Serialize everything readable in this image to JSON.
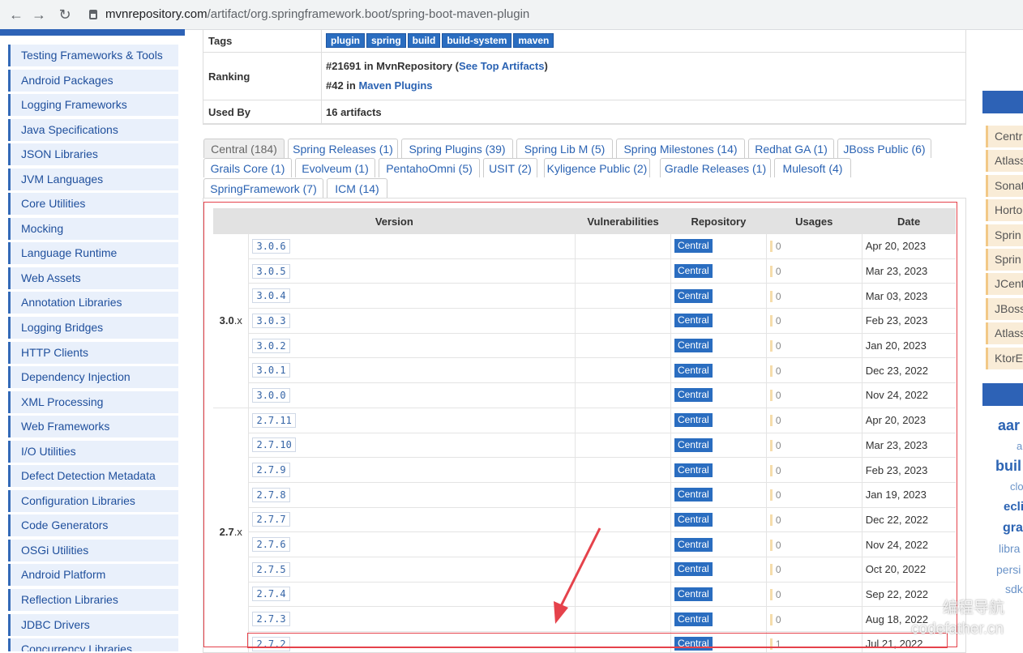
{
  "browser": {
    "url_host": "mvnrepository.com",
    "url_path": "/artifact/org.springframework.boot/spring-boot-maven-plugin"
  },
  "sidebar": {
    "items": [
      "Testing Frameworks & Tools",
      "Android Packages",
      "Logging Frameworks",
      "Java Specifications",
      "JSON Libraries",
      "JVM Languages",
      "Core Utilities",
      "Mocking",
      "Language Runtime",
      "Web Assets",
      "Annotation Libraries",
      "Logging Bridges",
      "HTTP Clients",
      "Dependency Injection",
      "XML Processing",
      "Web Frameworks",
      "I/O Utilities",
      "Defect Detection Metadata",
      "Configuration Libraries",
      "Code Generators",
      "OSGi Utilities",
      "Android Platform",
      "Reflection Libraries",
      "JDBC Drivers",
      "Concurrency Libraries"
    ]
  },
  "info": {
    "tags_label": "Tags",
    "tags": [
      "plugin",
      "spring",
      "build",
      "build-system",
      "maven"
    ],
    "ranking_label": "Ranking",
    "ranking_line1_prefix": "#21691 in MvnRepository (",
    "ranking_line1_link": "See Top Artifacts",
    "ranking_line1_suffix": ")",
    "ranking_line2_prefix": "#42 in ",
    "ranking_line2_link": "Maven Plugins",
    "usedby_label": "Used By",
    "usedby_value": "16 artifacts"
  },
  "tabs": {
    "row1": [
      "Central (184)",
      "Spring Releases (1)",
      "Spring Plugins (39)",
      "Spring Lib M (5)",
      "Spring Milestones (14)",
      "Redhat GA (1)",
      "JBoss Public (6)"
    ],
    "row2": [
      "Grails Core (1)",
      "Evolveum (1)",
      "PentahoOmni (5)",
      "USIT (2)",
      "Kyligence Public (2)",
      "Gradle Releases (1)",
      "Mulesoft (4)"
    ],
    "row3": [
      "SpringFramework (7)",
      "ICM (14)"
    ]
  },
  "table": {
    "headers": [
      "Version",
      "Vulnerabilities",
      "Repository",
      "Usages",
      "Date"
    ],
    "groups": [
      {
        "label": "3.0",
        "suffix": ".x",
        "rows": [
          {
            "version": "3.0.6",
            "repo": "Central",
            "usages": "0",
            "date": "Apr 20, 2023"
          },
          {
            "version": "3.0.5",
            "repo": "Central",
            "usages": "0",
            "date": "Mar 23, 2023"
          },
          {
            "version": "3.0.4",
            "repo": "Central",
            "usages": "0",
            "date": "Mar 03, 2023"
          },
          {
            "version": "3.0.3",
            "repo": "Central",
            "usages": "0",
            "date": "Feb 23, 2023"
          },
          {
            "version": "3.0.2",
            "repo": "Central",
            "usages": "0",
            "date": "Jan 20, 2023"
          },
          {
            "version": "3.0.1",
            "repo": "Central",
            "usages": "0",
            "date": "Dec 23, 2022"
          },
          {
            "version": "3.0.0",
            "repo": "Central",
            "usages": "0",
            "date": "Nov 24, 2022"
          }
        ]
      },
      {
        "label": "2.7",
        "suffix": ".x",
        "rows": [
          {
            "version": "2.7.11",
            "repo": "Central",
            "usages": "0",
            "date": "Apr 20, 2023"
          },
          {
            "version": "2.7.10",
            "repo": "Central",
            "usages": "0",
            "date": "Mar 23, 2023"
          },
          {
            "version": "2.7.9",
            "repo": "Central",
            "usages": "0",
            "date": "Feb 23, 2023"
          },
          {
            "version": "2.7.8",
            "repo": "Central",
            "usages": "0",
            "date": "Jan 19, 2023"
          },
          {
            "version": "2.7.7",
            "repo": "Central",
            "usages": "0",
            "date": "Dec 22, 2022"
          },
          {
            "version": "2.7.6",
            "repo": "Central",
            "usages": "0",
            "date": "Nov 24, 2022"
          },
          {
            "version": "2.7.5",
            "repo": "Central",
            "usages": "0",
            "date": "Oct 20, 2022"
          },
          {
            "version": "2.7.4",
            "repo": "Central",
            "usages": "0",
            "date": "Sep 22, 2022"
          },
          {
            "version": "2.7.3",
            "repo": "Central",
            "usages": "0",
            "date": "Aug 18, 2022"
          },
          {
            "version": "2.7.2",
            "repo": "Central",
            "usages": "1",
            "date": "Jul 21, 2022"
          }
        ]
      }
    ]
  },
  "right": {
    "repos": [
      "Centr",
      "Atlass",
      "Sonat",
      "Horto",
      "Sprin",
      "Sprin",
      "JCent",
      "JBoss",
      "Atlass",
      "KtorE"
    ],
    "cloud": [
      "aar",
      "app",
      "buil",
      "clo",
      "ecli",
      "gra",
      "libra",
      "persi",
      "sdk"
    ]
  },
  "watermark": {
    "line1": "编程导航",
    "line2": "codefather.cn"
  },
  "colors": {
    "accent": "#2d62b6",
    "highlight": "#e5424b"
  }
}
